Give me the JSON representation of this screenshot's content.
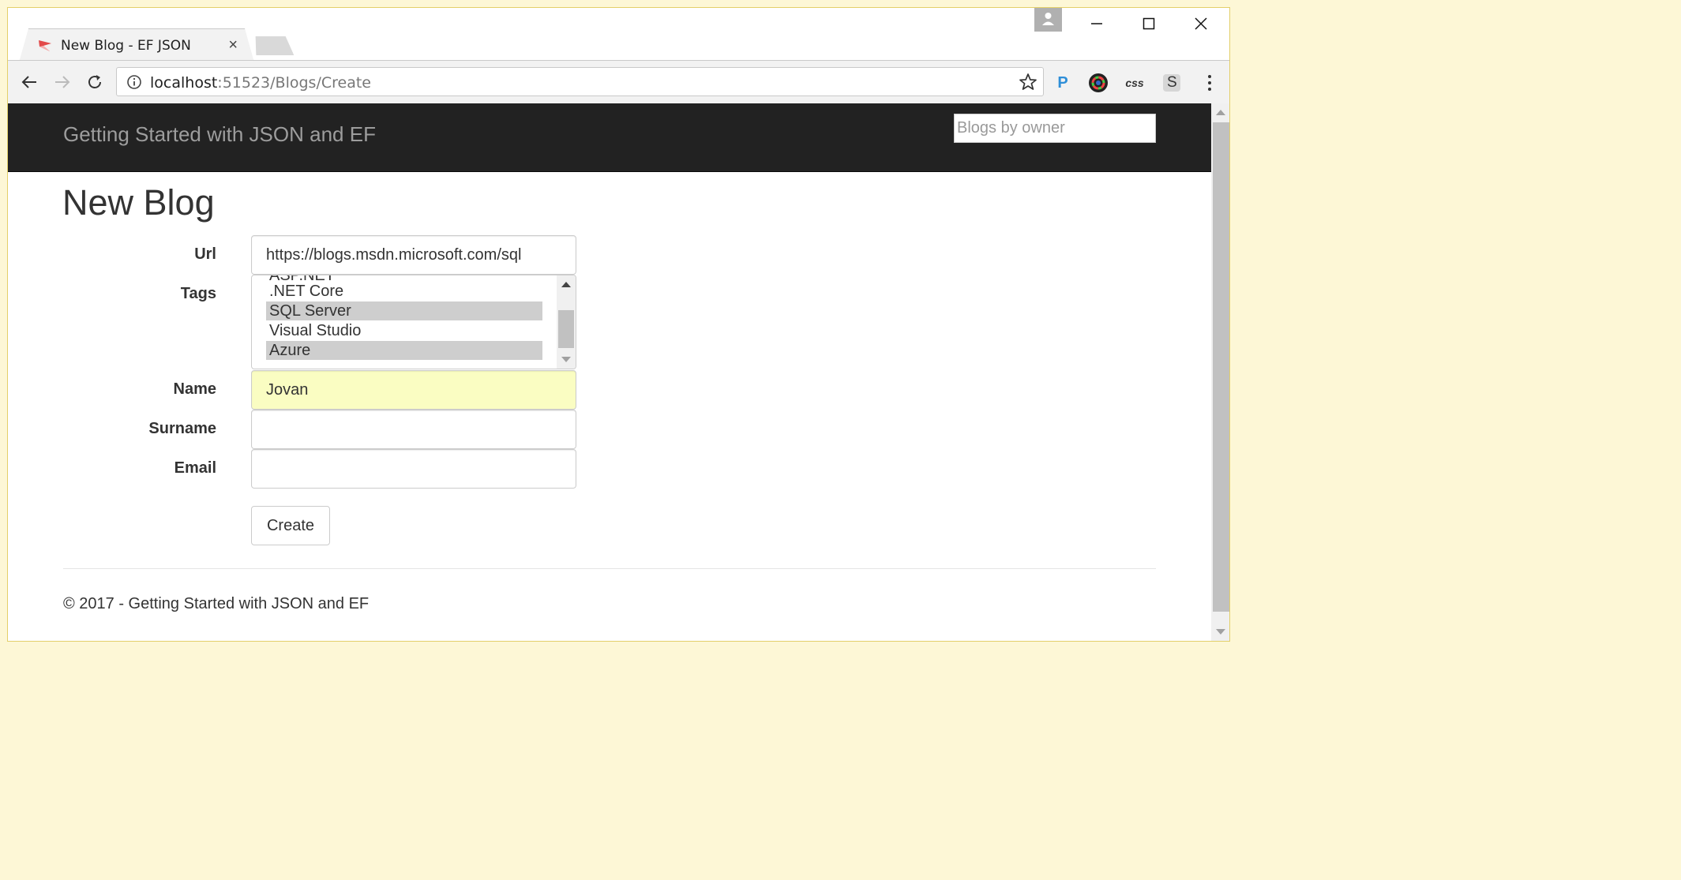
{
  "tab": {
    "title": "New Blog - EF JSON",
    "close": "×"
  },
  "address": {
    "host": "localhost",
    "rest": ":51523/Blogs/Create"
  },
  "extensions": {
    "p_label": "P",
    "css_label": "css",
    "s_label": "S"
  },
  "navbar": {
    "brand": "Getting Started with JSON and EF",
    "search_placeholder": "Blogs by owner"
  },
  "page": {
    "title": "New Blog"
  },
  "form": {
    "url_label": "Url",
    "url_value": "https://blogs.msdn.microsoft.com/sql",
    "tags_label": "Tags",
    "tags": [
      {
        "label": "ASP.NET",
        "selected": false
      },
      {
        "label": ".NET Core",
        "selected": false
      },
      {
        "label": "SQL Server",
        "selected": true
      },
      {
        "label": "Visual Studio",
        "selected": false
      },
      {
        "label": "Azure",
        "selected": true
      }
    ],
    "name_label": "Name",
    "name_value": "Jovan",
    "surname_label": "Surname",
    "surname_value": "",
    "email_label": "Email",
    "email_value": "",
    "create_label": "Create"
  },
  "footer": {
    "text": "© 2017 - Getting Started with JSON and EF"
  },
  "colors": {
    "navbar_bg": "#222222",
    "brand_text": "#9d9d9d",
    "autofill_bg": "#fafdc2",
    "selected_option": "#cecece"
  }
}
